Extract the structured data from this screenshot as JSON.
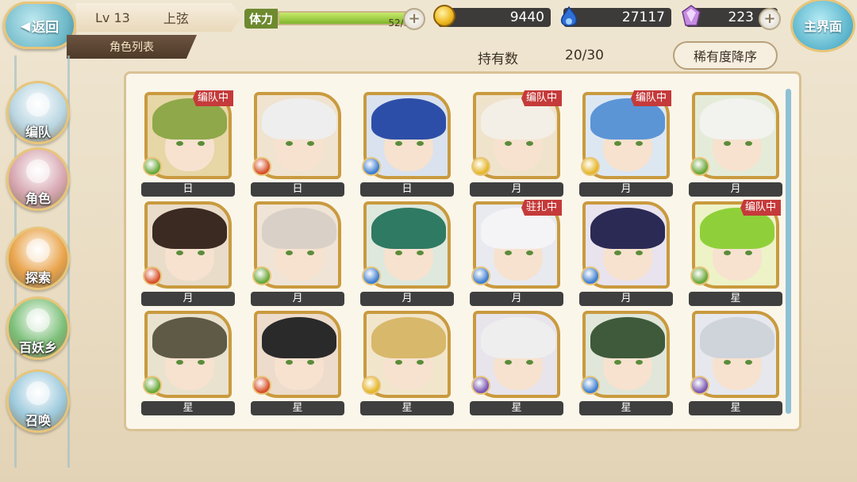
{
  "topbar": {
    "back_label": "返回",
    "level": "Lv 13",
    "moon_phase": "上弦",
    "section_tab": "角色列表",
    "stamina_label": "体力",
    "stamina_text": "52/52",
    "stamina_fraction": 1.0,
    "coins": "9440",
    "souls": "27117",
    "gems": "223",
    "main_label": "主界面"
  },
  "list_header": {
    "hold_label": "持有数",
    "hold_count": "20/30",
    "sort_label": "稀有度降序"
  },
  "nav": [
    {
      "label": "编队",
      "icon": "team-icon",
      "color": "#b9d6e2"
    },
    {
      "label": "角色",
      "icon": "character-icon",
      "color": "#d7a7b2"
    },
    {
      "label": "探索",
      "icon": "explore-icon",
      "color": "#e9a34a"
    },
    {
      "label": "百妖乡",
      "icon": "village-icon",
      "color": "#7bbf78"
    },
    {
      "label": "召唤",
      "icon": "summon-icon",
      "color": "#9cc9dc"
    }
  ],
  "elements": {
    "wind": "#6aa83a",
    "fire": "#d8502a",
    "water": "#3f7fd0",
    "light": "#e6b72a",
    "dark": "#7a58b4"
  },
  "characters": [
    {
      "rarity": "日",
      "badge": "编队中",
      "element": "wind",
      "hair": "#8fa84a",
      "bg": "#e7d6a6"
    },
    {
      "rarity": "日",
      "badge": "",
      "element": "fire",
      "hair": "#eeeeee",
      "bg": "#f0e3cf"
    },
    {
      "rarity": "日",
      "badge": "",
      "element": "water",
      "hair": "#2d4ea8",
      "bg": "#d9e2ee"
    },
    {
      "rarity": "月",
      "badge": "编队中",
      "element": "light",
      "hair": "#f3efe6",
      "bg": "#efe3cc"
    },
    {
      "rarity": "月",
      "badge": "编队中",
      "element": "light",
      "hair": "#5b95d6",
      "bg": "#dde7f2"
    },
    {
      "rarity": "月",
      "badge": "",
      "element": "wind",
      "hair": "#f2f2ef",
      "bg": "#e4ecd9"
    },
    {
      "rarity": "月",
      "badge": "",
      "element": "fire",
      "hair": "#3a2a22",
      "bg": "#e9dcc9"
    },
    {
      "rarity": "月",
      "badge": "",
      "element": "wind",
      "hair": "#d9d1c7",
      "bg": "#efe4d6"
    },
    {
      "rarity": "月",
      "badge": "",
      "element": "water",
      "hair": "#2f7a63",
      "bg": "#dfe8dd"
    },
    {
      "rarity": "月",
      "badge": "驻扎中",
      "element": "water",
      "hair": "#f4f4f6",
      "bg": "#e8eaf0"
    },
    {
      "rarity": "月",
      "badge": "",
      "element": "water",
      "hair": "#2b2a55",
      "bg": "#e9e3ee"
    },
    {
      "rarity": "星",
      "badge": "编队中",
      "element": "wind",
      "hair": "#8fd03a",
      "bg": "#eef2c7"
    },
    {
      "rarity": "星",
      "badge": "",
      "element": "wind",
      "hair": "#5e5a45",
      "bg": "#e9e2cf"
    },
    {
      "rarity": "星",
      "badge": "",
      "element": "fire",
      "hair": "#2a2a2a",
      "bg": "#eddccb"
    },
    {
      "rarity": "星",
      "badge": "",
      "element": "light",
      "hair": "#d8b86a",
      "bg": "#f1e6cc"
    },
    {
      "rarity": "星",
      "badge": "",
      "element": "dark",
      "hair": "#eeeeee",
      "bg": "#e8e4ec"
    },
    {
      "rarity": "星",
      "badge": "",
      "element": "water",
      "hair": "#3e5a3a",
      "bg": "#e0e6d9"
    },
    {
      "rarity": "星",
      "badge": "",
      "element": "dark",
      "hair": "#cfd3da",
      "bg": "#e6e8ee"
    }
  ]
}
